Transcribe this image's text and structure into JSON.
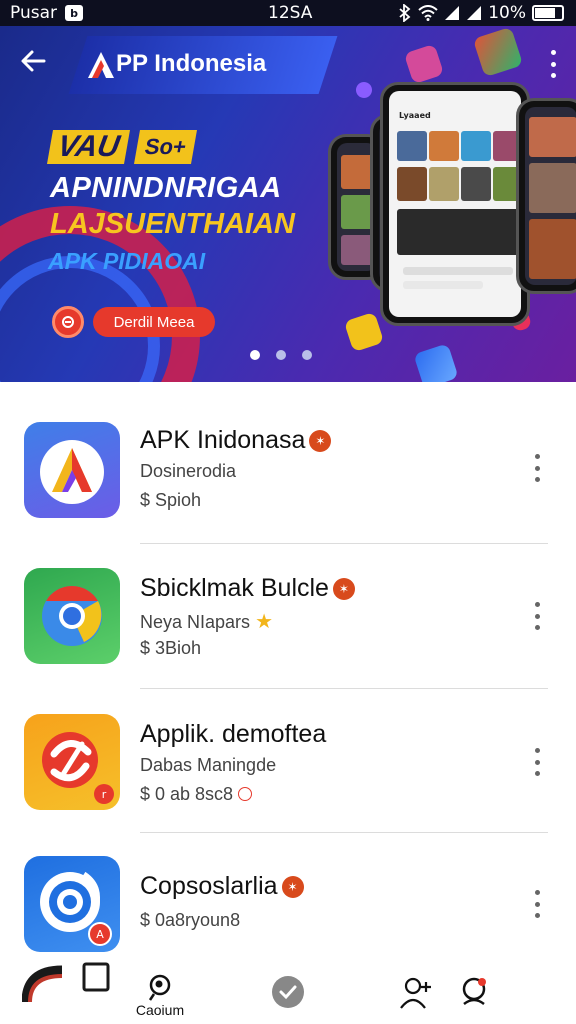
{
  "status_bar": {
    "carrier": "Pusar",
    "carrier_badge": "b",
    "time": "12SA",
    "icons": [
      "bluetooth-icon",
      "wifi-icon",
      "signal-icon",
      "signal-icon"
    ],
    "battery_text": "10%",
    "battery_level": 0.7
  },
  "app_bar": {
    "title": "PP Indonesia",
    "back_icon": "arrow-left-icon",
    "menu_icon": "more-vertical-icon",
    "logo_icon": "app-logo-icon"
  },
  "hero": {
    "badge_a": "VAU",
    "badge_b": "So+",
    "line1": "APNINDNRIGAA",
    "line2": "LAJSUENTHAIAN",
    "line3": "APK PIDIAOAI",
    "cta_label": "Derdil Meea",
    "phone_header": "Lyaaed",
    "pages": 3,
    "active_page": 0
  },
  "apps": [
    {
      "name": "APK Inidonasa",
      "subtitle": "Dosinerodia",
      "price": "$ Spioh",
      "verified": true,
      "icon": "app-a-icon",
      "icon_colors": [
        "#3f7fe8",
        "#6c5ce7"
      ]
    },
    {
      "name": "Sbicklmak Bulcle",
      "subtitle": "Neya NIapars",
      "subtitle_icon": "star-icon",
      "price": "$ 3Bioh",
      "verified": true,
      "icon": "chrome-style-icon",
      "icon_colors": [
        "#2fa84f",
        "#5ccf6a"
      ]
    },
    {
      "name": "Applik. demoftea",
      "subtitle": "Dabas Maningde",
      "price": "$ 0 ab 8sc8",
      "price_icon": "info-circle-icon",
      "verified": false,
      "icon": "red-swirl-icon",
      "icon_colors": [
        "#f7a21b",
        "#f5c02a"
      ]
    },
    {
      "name": "Copsoslarlia",
      "subtitle": "",
      "price": "$ 0a8ryoun8",
      "verified": true,
      "icon": "target-icon",
      "icon_colors": [
        "#1f6fe0",
        "#3f8ff0"
      ]
    }
  ],
  "bottom_nav": {
    "items": [
      {
        "label": "",
        "icon": "square-frame-icon"
      },
      {
        "label": "Caoium",
        "icon": "search-person-icon"
      },
      {
        "label": "",
        "icon": "check-circle-icon"
      },
      {
        "label": "",
        "icon": "person-add-icon"
      },
      {
        "label": "",
        "icon": "notification-bell-icon"
      }
    ]
  },
  "colors": {
    "hero_start": "#1a2a8a",
    "hero_end": "#6a1fa0",
    "accent_yellow": "#f2c21b",
    "accent_red": "#e6392c",
    "verified_badge": "#d84a1c"
  }
}
